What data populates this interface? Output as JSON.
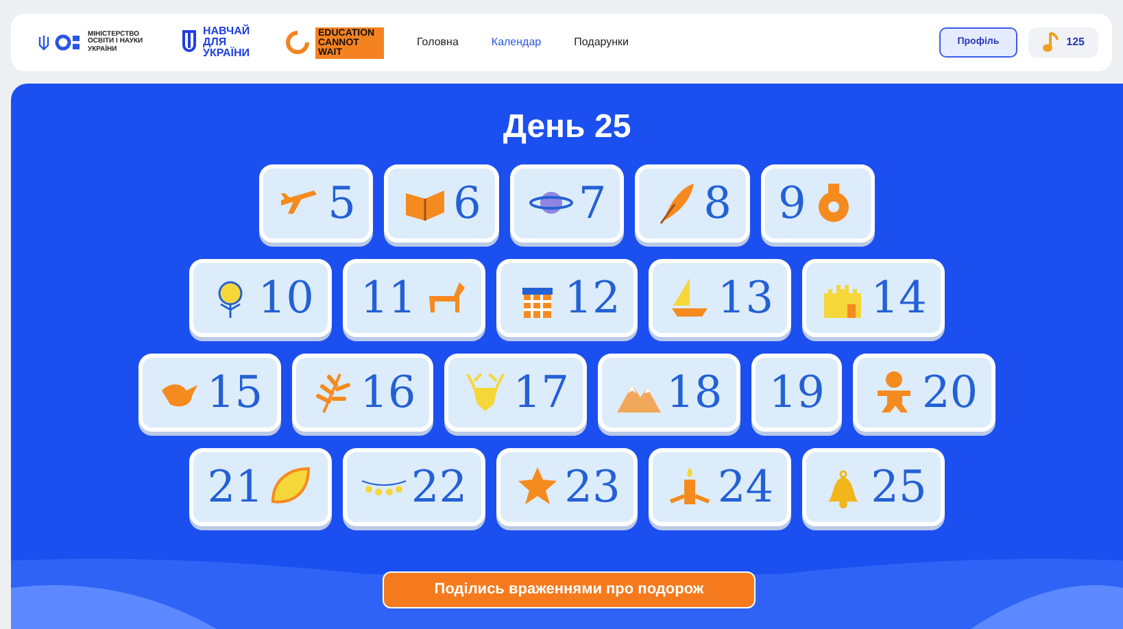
{
  "header": {
    "ministry_logo": "МІНІСТЕРСТВО ОСВІТИ І НАУКИ УКРАЇНИ",
    "partner_logo": "НАВЧАЙ ДЛЯ УКРАЇНИ",
    "ecw_logo": "EDUCATION CANNOT WAIT",
    "nav": [
      {
        "label": "Головна",
        "selected": false
      },
      {
        "label": "Календар",
        "selected": true
      },
      {
        "label": "Подарунки",
        "selected": false
      }
    ],
    "profile_button": "Профіль",
    "score": "125"
  },
  "title": "День 25",
  "ticket_rows": [
    [
      {
        "number": "5",
        "kind": "plane"
      },
      {
        "number": "6",
        "kind": "book"
      },
      {
        "number": "7",
        "kind": "planet"
      },
      {
        "number": "8",
        "kind": "feather"
      },
      {
        "number": "9",
        "kind": "jug"
      }
    ],
    [
      {
        "number": "10",
        "kind": "flower"
      },
      {
        "number": "11",
        "kind": "horse"
      },
      {
        "number": "12",
        "kind": "gift"
      },
      {
        "number": "13",
        "kind": "boat"
      },
      {
        "number": "14",
        "kind": "castle"
      }
    ],
    [
      {
        "number": "15",
        "kind": "bird"
      },
      {
        "number": "16",
        "kind": "branch"
      },
      {
        "number": "17",
        "kind": "deer"
      },
      {
        "number": "18",
        "kind": "mountains"
      },
      {
        "number": "19",
        "kind": "plain"
      },
      {
        "number": "20",
        "kind": "gingerbread"
      }
    ],
    [
      {
        "number": "21",
        "kind": "leaf"
      },
      {
        "number": "22",
        "kind": "lights"
      },
      {
        "number": "23",
        "kind": "star"
      },
      {
        "number": "24",
        "kind": "candle"
      },
      {
        "number": "25",
        "kind": "bell"
      }
    ]
  ],
  "share_button": "Поділись враженнями про подорож"
}
